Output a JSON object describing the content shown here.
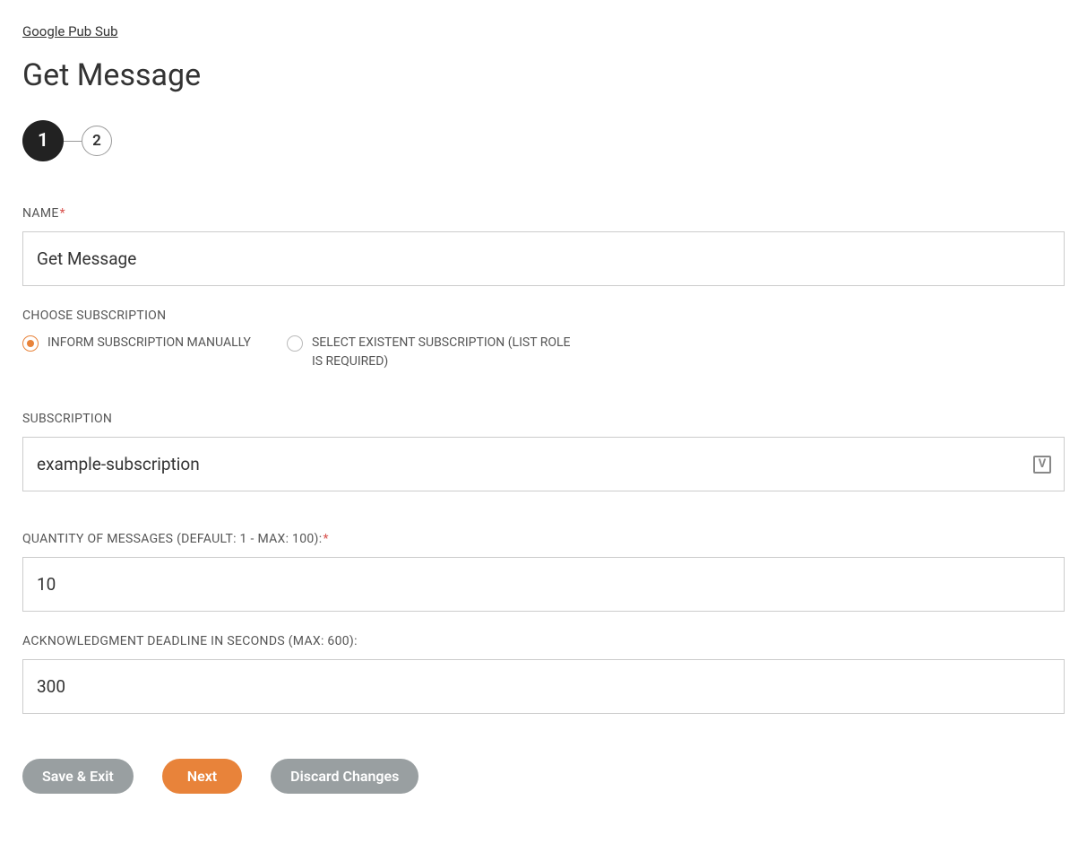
{
  "breadcrumb": "Google Pub Sub",
  "pageTitle": "Get Message",
  "stepper": {
    "step1": "1",
    "step2": "2"
  },
  "fields": {
    "name": {
      "label": "NAME",
      "value": "Get Message"
    },
    "chooseSubscription": {
      "label": "CHOOSE SUBSCRIPTION",
      "option1": "INFORM SUBSCRIPTION MANUALLY",
      "option2": "SELECT EXISTENT SUBSCRIPTION (LIST ROLE IS REQUIRED)"
    },
    "subscription": {
      "label": "SUBSCRIPTION",
      "value": "example-subscription",
      "iconLetter": "V"
    },
    "quantity": {
      "label": "QUANTITY OF MESSAGES (DEFAULT: 1 - MAX: 100):",
      "value": "10"
    },
    "ackDeadline": {
      "label": "ACKNOWLEDGMENT DEADLINE IN SECONDS (MAX: 600):",
      "value": "300"
    }
  },
  "buttons": {
    "saveExit": "Save & Exit",
    "next": "Next",
    "discard": "Discard Changes"
  },
  "requiredMark": "*"
}
